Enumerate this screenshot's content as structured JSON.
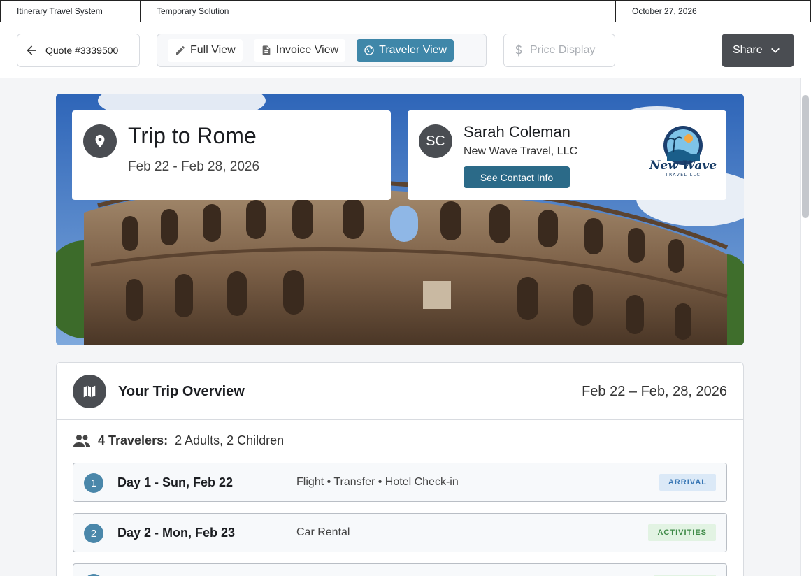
{
  "infobar": {
    "system_name": "Itinerary Travel System",
    "note": "Temporary Solution",
    "date": "October 27, 2026"
  },
  "toolbar": {
    "quote_label": "Quote #3339500",
    "views": [
      {
        "label": "Full View",
        "icon": "pencil-icon",
        "active": false
      },
      {
        "label": "Invoice View",
        "icon": "document-icon",
        "active": false
      },
      {
        "label": "Traveler View",
        "icon": "globe-icon",
        "active": true
      }
    ],
    "price_display_label": "Price Display",
    "share_label": "Share"
  },
  "hero": {
    "trip_title": "Trip to Rome",
    "trip_dates": "Feb 22 - Feb 28, 2026",
    "agent_initials": "SC",
    "agent_name": "Sarah Coleman",
    "agency_name": "New Wave Travel, LLC",
    "contact_button": "See Contact Info",
    "logo_text": "New Wave",
    "logo_subtext": "TRAVEL LLC"
  },
  "overview": {
    "title": "Your Trip Overview",
    "dates": "Feb 22 – Feb, 28, 2026",
    "travelers_label": "4 Travelers:",
    "travelers_detail": "2 Adults, 2 Children",
    "days": [
      {
        "num": "1",
        "title": "Day 1 - Sun, Feb 22",
        "items": "Flight  •  Transfer  •  Hotel Check-in",
        "badge": "ARRIVAL",
        "badge_type": "arrival"
      },
      {
        "num": "2",
        "title": "Day 2 - Mon, Feb 23",
        "items": "Car Rental",
        "badge": "ACTIVITIES",
        "badge_type": "activities"
      },
      {
        "num": "3",
        "title": "",
        "items": "",
        "badge": "",
        "badge_type": "activities"
      }
    ]
  },
  "colors": {
    "accent": "#3f87a9",
    "dark": "#4a4d52",
    "contact_button": "#2b6a88"
  }
}
